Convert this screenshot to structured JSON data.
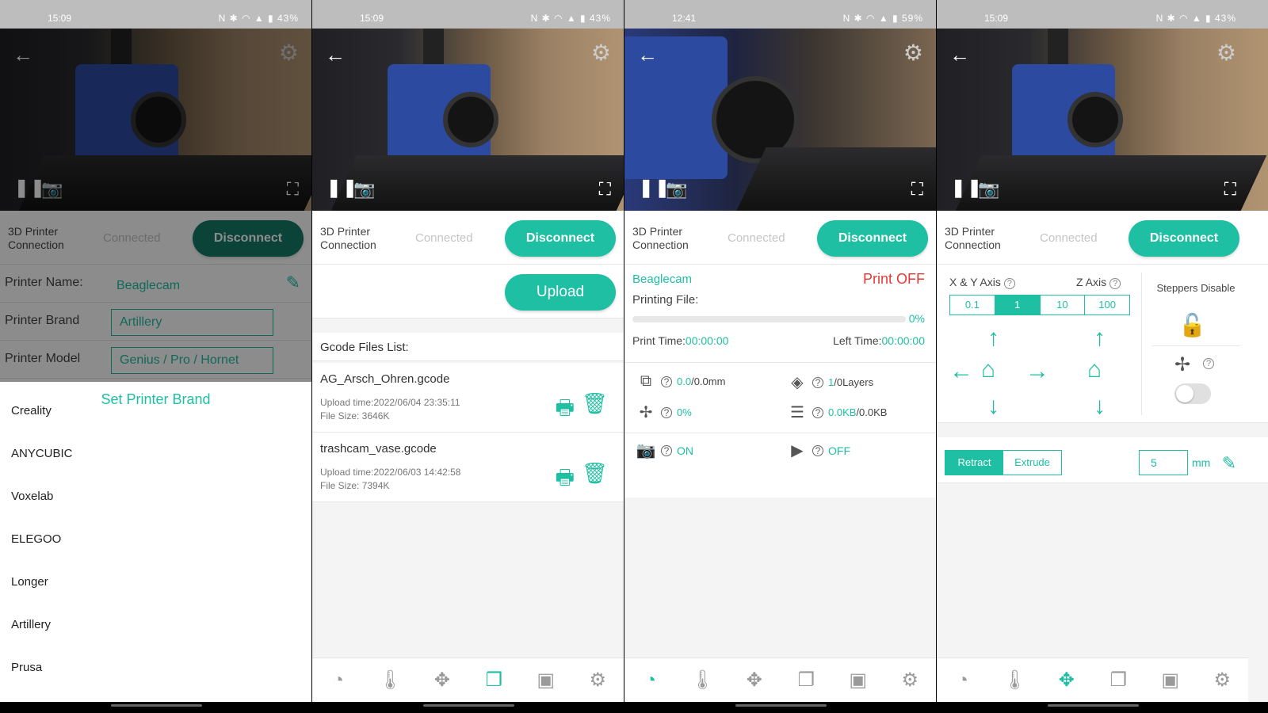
{
  "status": [
    {
      "time": "15:09",
      "battery": "43%"
    },
    {
      "time": "15:09",
      "battery": "43%"
    },
    {
      "time": "12:41",
      "battery": "59%"
    },
    {
      "time": "15:09",
      "battery": "43%"
    }
  ],
  "connection": {
    "label": "3D Printer Connection",
    "state": "Connected",
    "button": "Disconnect"
  },
  "nav_icons": [
    "dashboard-icon",
    "thermometer-icon",
    "move-icon",
    "files-icon",
    "video-file-icon",
    "settings-icon"
  ],
  "screen1": {
    "printer_name_label": "Printer Name:",
    "printer_name_value": "Beaglecam",
    "printer_brand_label": "Printer Brand",
    "printer_brand_value": "Artillery",
    "printer_model_label": "Printer Model",
    "printer_model_value": "Genius / Pro / Hornet",
    "sheet_title": "Set Printer Brand",
    "brands": [
      "Creality",
      "ANYCUBIC",
      "Voxelab",
      "ELEGOO",
      "Longer",
      "Artillery",
      "Prusa"
    ]
  },
  "screen2": {
    "upload_label": "Upload",
    "list_title": "Gcode Files List:",
    "files": [
      {
        "name": "AG_Arsch_Ohren.gcode",
        "upload": "Upload time:2022/06/04 23:35:11",
        "size": "File Size: 3646K"
      },
      {
        "name": "trashcam_vase.gcode",
        "upload": "Upload time:2022/06/03 14:42:58",
        "size": "File Size: 7394K"
      }
    ]
  },
  "screen3": {
    "printer": "Beaglecam",
    "print_status": "Print OFF",
    "printing_file_label": "Printing File:",
    "progress": 0,
    "progress_label": "0%",
    "print_time_label": "Print Time:",
    "print_time": "00:00:00",
    "left_time_label": "Left Time:",
    "left_time": "00:00:00",
    "height_value": "0.0",
    "height_total": "/0.0mm",
    "layers_value": "1",
    "layers_total": "/0Layers",
    "fan_value": "0%",
    "data_value": "0.0KB",
    "data_total": "/0.0KB",
    "camera_state": "ON",
    "record_state": "OFF"
  },
  "screen4": {
    "xy_label": "X & Y Axis",
    "z_label": "Z Axis",
    "steps": [
      "0.1",
      "1",
      "10",
      "100"
    ],
    "selected_step": "1",
    "steppers_label": "Steppers Disable",
    "retract_label": "Retract",
    "extrude_label": "Extrude",
    "amount": "5",
    "unit": "mm"
  },
  "colors": {
    "accent": "#1ebfa3",
    "alert": "#e53935"
  }
}
